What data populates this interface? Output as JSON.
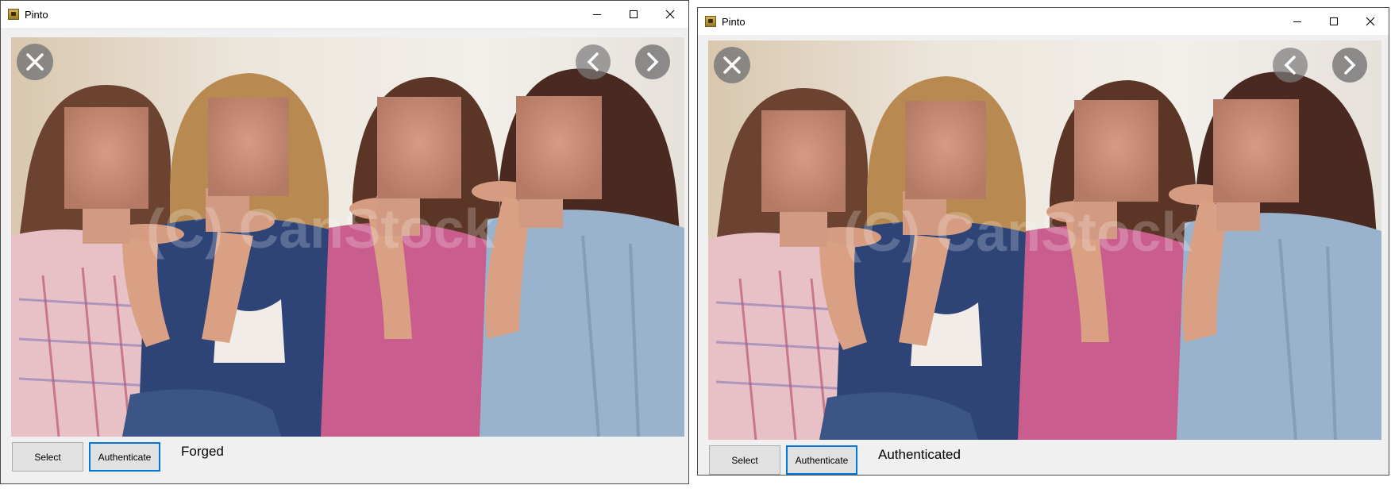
{
  "windows": [
    {
      "title": "Pinto",
      "buttons": {
        "select_label": "Select",
        "authenticate_label": "Authenticate"
      },
      "result_text": "Forged",
      "image": {
        "watermark": "(C) CanStock"
      }
    },
    {
      "title": "Pinto",
      "buttons": {
        "select_label": "Select",
        "authenticate_label": "Authenticate"
      },
      "result_text": "Authenticated",
      "image": {
        "watermark": "(C) CanStock"
      }
    }
  ],
  "icons": {
    "app": "app-icon",
    "minimize": "minimize-icon",
    "maximize": "maximize-icon",
    "close": "close-icon",
    "overlay_close": "close-circle-icon",
    "overlay_prev": "chevron-left-icon",
    "overlay_next": "chevron-right-icon"
  },
  "colors": {
    "authenticate_focus_border": "#0078d7",
    "window_background": "#f0f0f0",
    "button_background": "#e1e1e1"
  }
}
